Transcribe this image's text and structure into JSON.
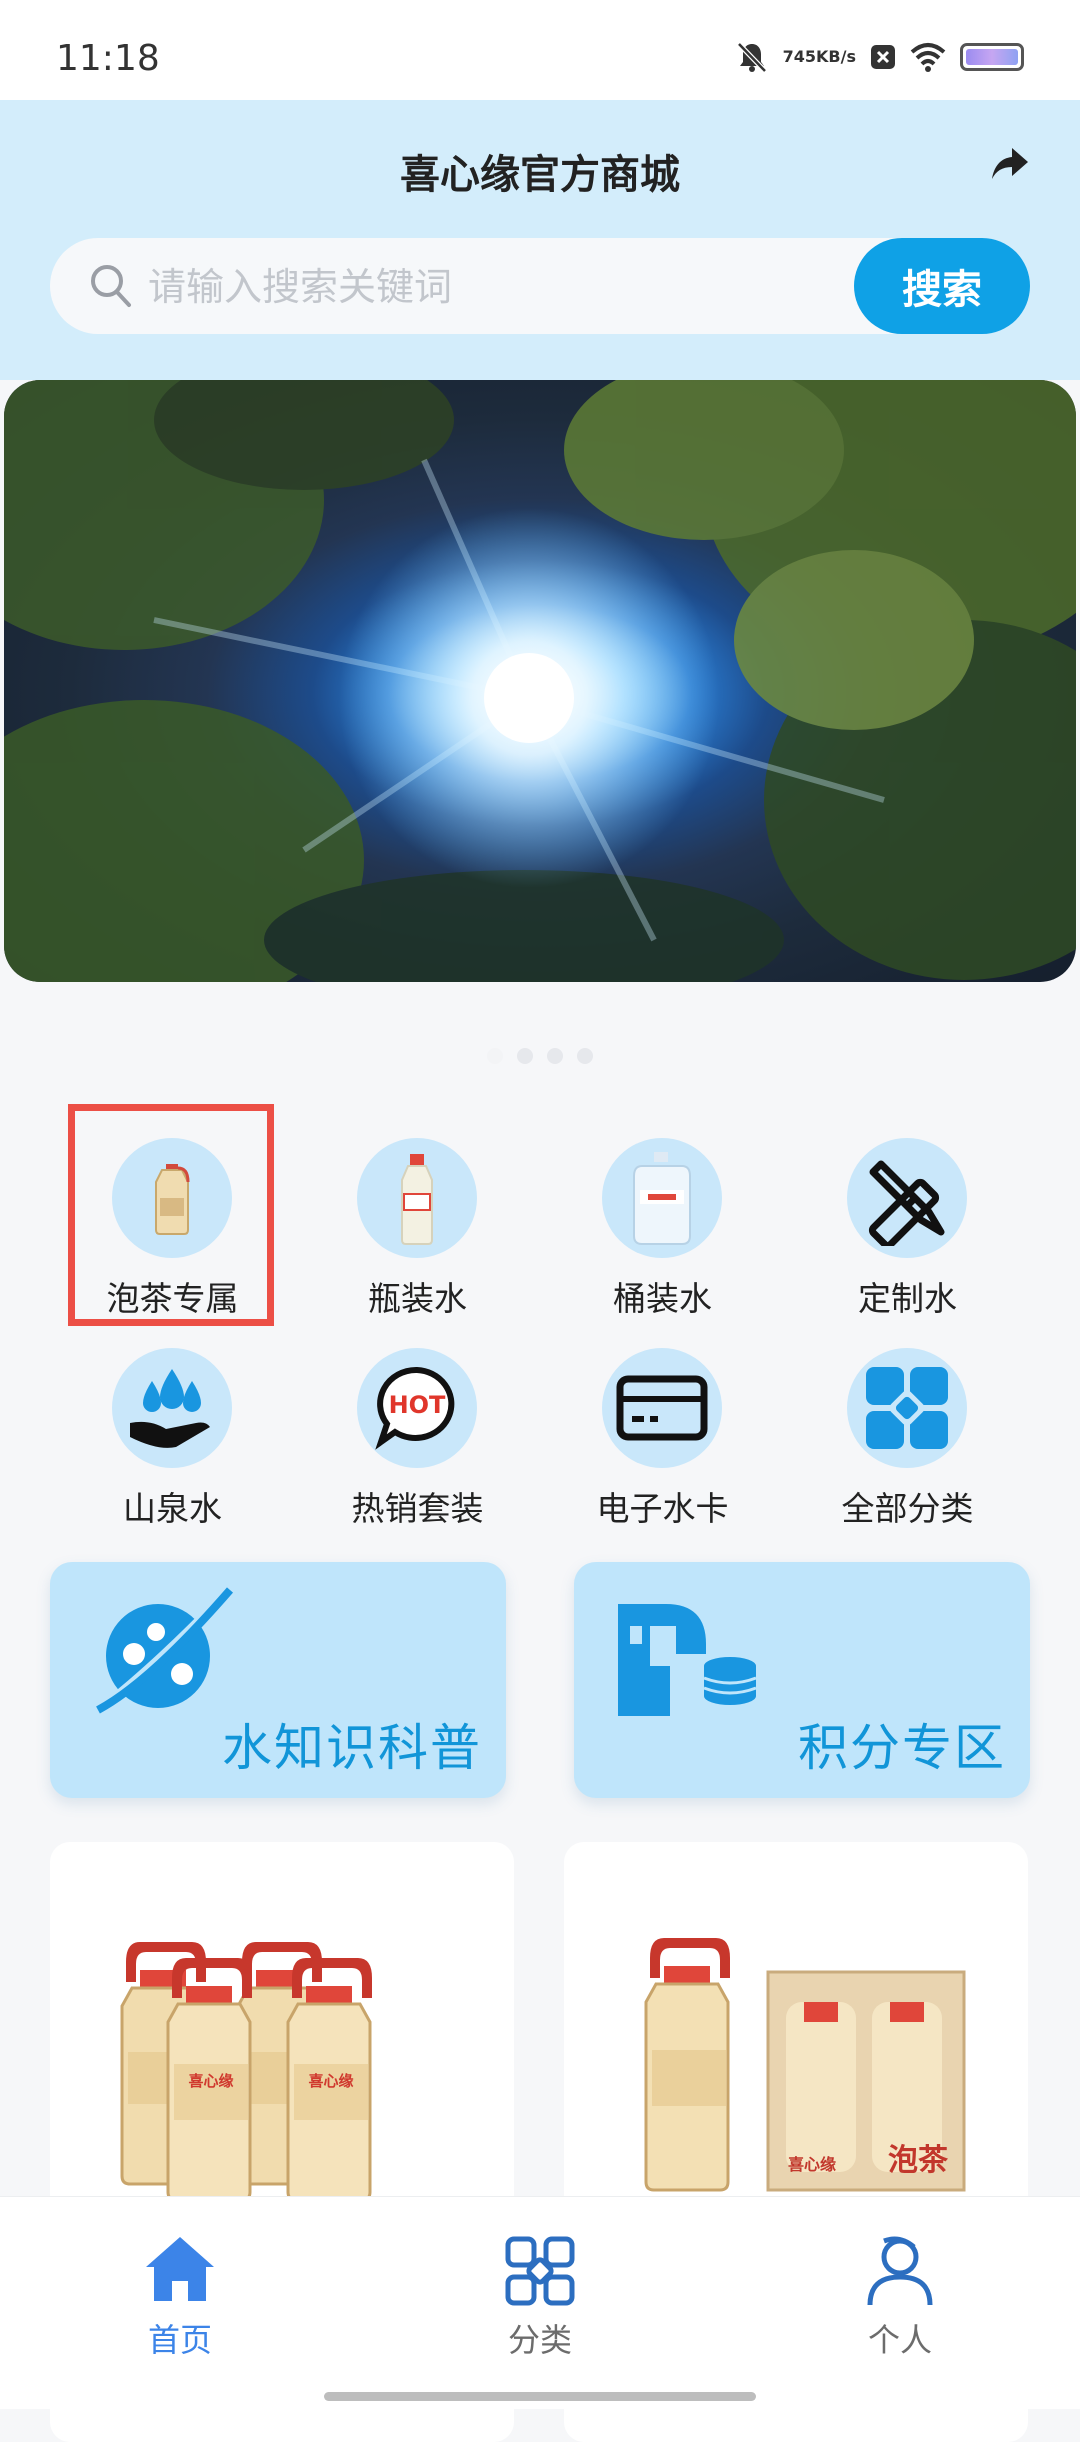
{
  "status_bar": {
    "time": "11:18",
    "net_speed_value": "745",
    "net_speed_unit": "KB/s",
    "icons": [
      "bell-muted-icon",
      "notification-x-icon",
      "wifi-icon",
      "battery-icon"
    ]
  },
  "header": {
    "title": "喜心缘官方商城",
    "share_icon": "share-icon"
  },
  "search": {
    "placeholder": "请输入搜索关键词",
    "value": "",
    "button_label": "搜索"
  },
  "banner": {
    "image": "sunlight-through-trees",
    "dots_count": 4,
    "active_index": 0
  },
  "categories": [
    {
      "label": "泡茶专属",
      "icon": "tea-water-bottle-icon"
    },
    {
      "label": "瓶装水",
      "icon": "bottled-water-icon"
    },
    {
      "label": "桶装水",
      "icon": "barrel-water-icon"
    },
    {
      "label": "定制水",
      "icon": "pencil-ruler-icon"
    },
    {
      "label": "山泉水",
      "icon": "water-drops-hand-icon"
    },
    {
      "label": "热销套装",
      "icon": "hot-bubble-icon"
    },
    {
      "label": "电子水卡",
      "icon": "card-icon"
    },
    {
      "label": "全部分类",
      "icon": "grid-icon"
    }
  ],
  "promos": [
    {
      "label": "水知识科普",
      "icon": "knowledge-planet-icon"
    },
    {
      "label": "积分专区",
      "icon": "points-coins-icon"
    }
  ],
  "products": [
    {
      "image": "four-bottle-pack"
    },
    {
      "image": "two-bottle-gift-box"
    }
  ],
  "bottle_texts": {
    "brand": "喜心缘",
    "box_label": "泡茶"
  },
  "tabs": [
    {
      "label": "首页",
      "icon": "home-icon",
      "active": true
    },
    {
      "label": "分类",
      "icon": "category-grid-icon",
      "active": false
    },
    {
      "label": "个人",
      "icon": "person-icon",
      "active": false
    }
  ],
  "colors": {
    "accent": "#0fa1e6",
    "header_bg": "#d3edfb",
    "icon_circle": "#c9e7fa",
    "tab_active": "#3c84e8",
    "tab_inactive": "#6c6c6c",
    "highlight": "#ec4f46"
  }
}
